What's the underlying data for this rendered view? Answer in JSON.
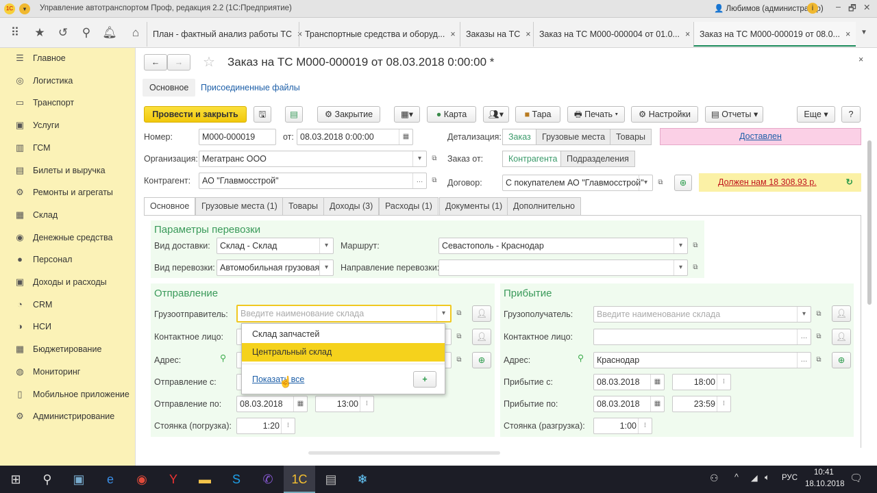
{
  "window": {
    "title": "Управление автотранспортом Проф, редакция 2.2  (1С:Предприятие)",
    "user": "Любимов (администратор)"
  },
  "open_tabs": [
    {
      "label": "План - фактный анализ работы ТС"
    },
    {
      "label": "Транспортные средства и оборуд..."
    },
    {
      "label": "Заказы на ТС"
    },
    {
      "label": "Заказ на ТС М000-000004 от 01.0..."
    },
    {
      "label": "Заказ на ТС М000-000019 от 08.0...",
      "active": true
    }
  ],
  "sidebar": {
    "items": [
      {
        "label": "Главное",
        "icon": "menu-icon"
      },
      {
        "label": "Логистика",
        "icon": "compass-icon"
      },
      {
        "label": "Транспорт",
        "icon": "truck-icon"
      },
      {
        "label": "Услуги",
        "icon": "services-icon"
      },
      {
        "label": "ГСМ",
        "icon": "fuel-icon"
      },
      {
        "label": "Билеты и выручка",
        "icon": "tickets-icon"
      },
      {
        "label": "Ремонты и агрегаты",
        "icon": "repair-icon"
      },
      {
        "label": "Склад",
        "icon": "warehouse-icon"
      },
      {
        "label": "Денежные средства",
        "icon": "money-icon"
      },
      {
        "label": "Персонал",
        "icon": "person-icon"
      },
      {
        "label": "Доходы и расходы",
        "icon": "income-icon"
      },
      {
        "label": "CRM",
        "icon": "crm-icon"
      },
      {
        "label": "НСИ",
        "icon": "reference-icon"
      },
      {
        "label": "Бюджетирование",
        "icon": "budget-icon"
      },
      {
        "label": "Мониторинг",
        "icon": "monitor-icon"
      },
      {
        "label": "Мобильное приложение",
        "icon": "mobile-icon"
      },
      {
        "label": "Администрирование",
        "icon": "gear-icon"
      }
    ]
  },
  "doc": {
    "title": "Заказ на ТС М000-000019 от 08.03.2018 0:00:00 *",
    "subnav": {
      "main": "Основное",
      "files": "Присоединенные файлы"
    },
    "toolbar": {
      "post_close": "Провести и закрыть",
      "closing": "Закрытие",
      "map": "Карта",
      "tara": "Тара",
      "print": "Печать",
      "settings": "Настройки",
      "reports": "Отчеты",
      "more": "Еще",
      "help": "?"
    },
    "number_label": "Номер:",
    "number": "М000-000019",
    "from_label": "от:",
    "date": "08.03.2018  0:00:00",
    "org_label": "Организация:",
    "org": "Мегатранс ООО",
    "contractor_label": "Контрагент:",
    "contractor": "АО \"Главмосстрой\"",
    "detail_label": "Детализация:",
    "detail_options": [
      "Заказ",
      "Грузовые места",
      "Товары"
    ],
    "status": "Доставлен",
    "order_from_label": "Заказ от:",
    "order_from_options": [
      "Контрагента",
      "Подразделения"
    ],
    "contract_label": "Договор:",
    "contract": "С покупателем АО \"Главмосстрой\"",
    "debt": "Должен нам 18 308.93 р.",
    "form_tabs": [
      "Основное",
      "Грузовые места (1)",
      "Товары",
      "Доходы (3)",
      "Расходы (1)",
      "Документы (1)",
      "Дополнительно"
    ],
    "params": {
      "heading": "Параметры перевозки",
      "delivery_label": "Вид доставки:",
      "delivery": "Склад - Склад",
      "transport_label": "Вид перевозки:",
      "transport": "Автомобильная грузовая",
      "route_label": "Маршрут:",
      "route": "Севастополь - Краснодар",
      "direction_label": "Направление перевозки:",
      "direction": ""
    },
    "departure": {
      "heading": "Отправление",
      "shipper_label": "Грузоотправитель:",
      "shipper_placeholder": "Введите наименование склада",
      "contact_label": "Контактное лицо:",
      "address_label": "Адрес:",
      "from_label": "Отправление с:",
      "to_label": "Отправление по:",
      "to_date": "08.03.2018",
      "to_time": "13:00",
      "stop_label": "Стоянка (погрузка):",
      "stop": "1:20"
    },
    "dropdown": {
      "items": [
        "Склад запчастей",
        "Центральный склад"
      ],
      "highlighted": 1,
      "show_all": "Показать все"
    },
    "arrival": {
      "heading": "Прибытие",
      "consignee_label": "Грузополучатель:",
      "consignee_placeholder": "Введите наименование склада",
      "contact_label": "Контактное лицо:",
      "address_label": "Адрес:",
      "address": "Краснодар",
      "from_label": "Прибытие с:",
      "from_date": "08.03.2018",
      "from_time": "18:00",
      "to_label": "Прибытие по:",
      "to_date": "08.03.2018",
      "to_time": "23:59",
      "stop_label": "Стоянка (разгрузка):",
      "stop": "1:00"
    }
  },
  "taskbar": {
    "lang": "РУС",
    "time": "10:41",
    "date": "18.10.2018"
  },
  "colors": {
    "sidebar": "#fbf2b7",
    "primary": "#f5d21c",
    "accent_green": "#3a9a5a",
    "status_bg": "#fbd0e6",
    "debt_bg": "#fbf1a6",
    "debt_text": "#c0141c"
  }
}
